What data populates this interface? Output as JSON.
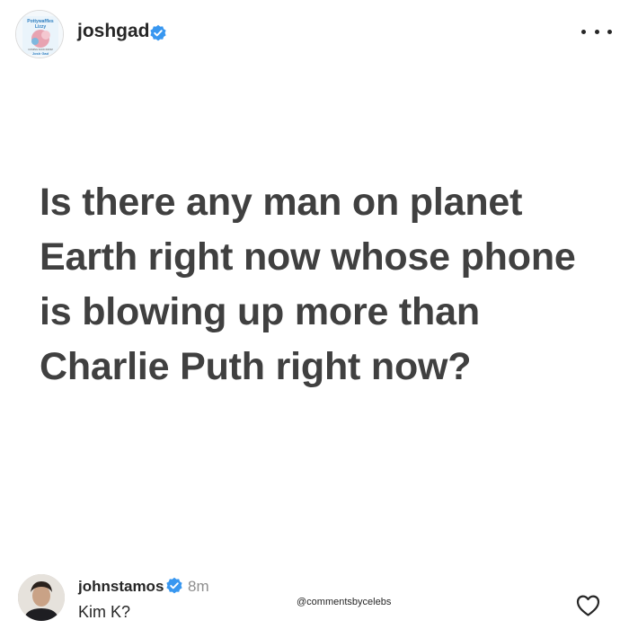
{
  "post": {
    "author": {
      "username": "joshgad",
      "avatar_book": {
        "title_line1": "Pottywaffles",
        "title_line2": "Lizzy",
        "subtitle": "COMING SOON FROM",
        "author_credit": "Josh Gad"
      }
    },
    "text": "Is there any man on planet Earth right now whose phone is blowing up more than Charlie Puth right now?"
  },
  "comment": {
    "username": "johnstamos",
    "time": "8m",
    "text": "Kim K?"
  },
  "watermark": "@commentsbycelebs",
  "icons": {
    "verified": "verified-badge-icon",
    "more": "more-options-icon",
    "like": "heart-icon"
  },
  "colors": {
    "verified_blue": "#3897f0",
    "post_text": "#404040",
    "muted": "#8e8e8e"
  }
}
